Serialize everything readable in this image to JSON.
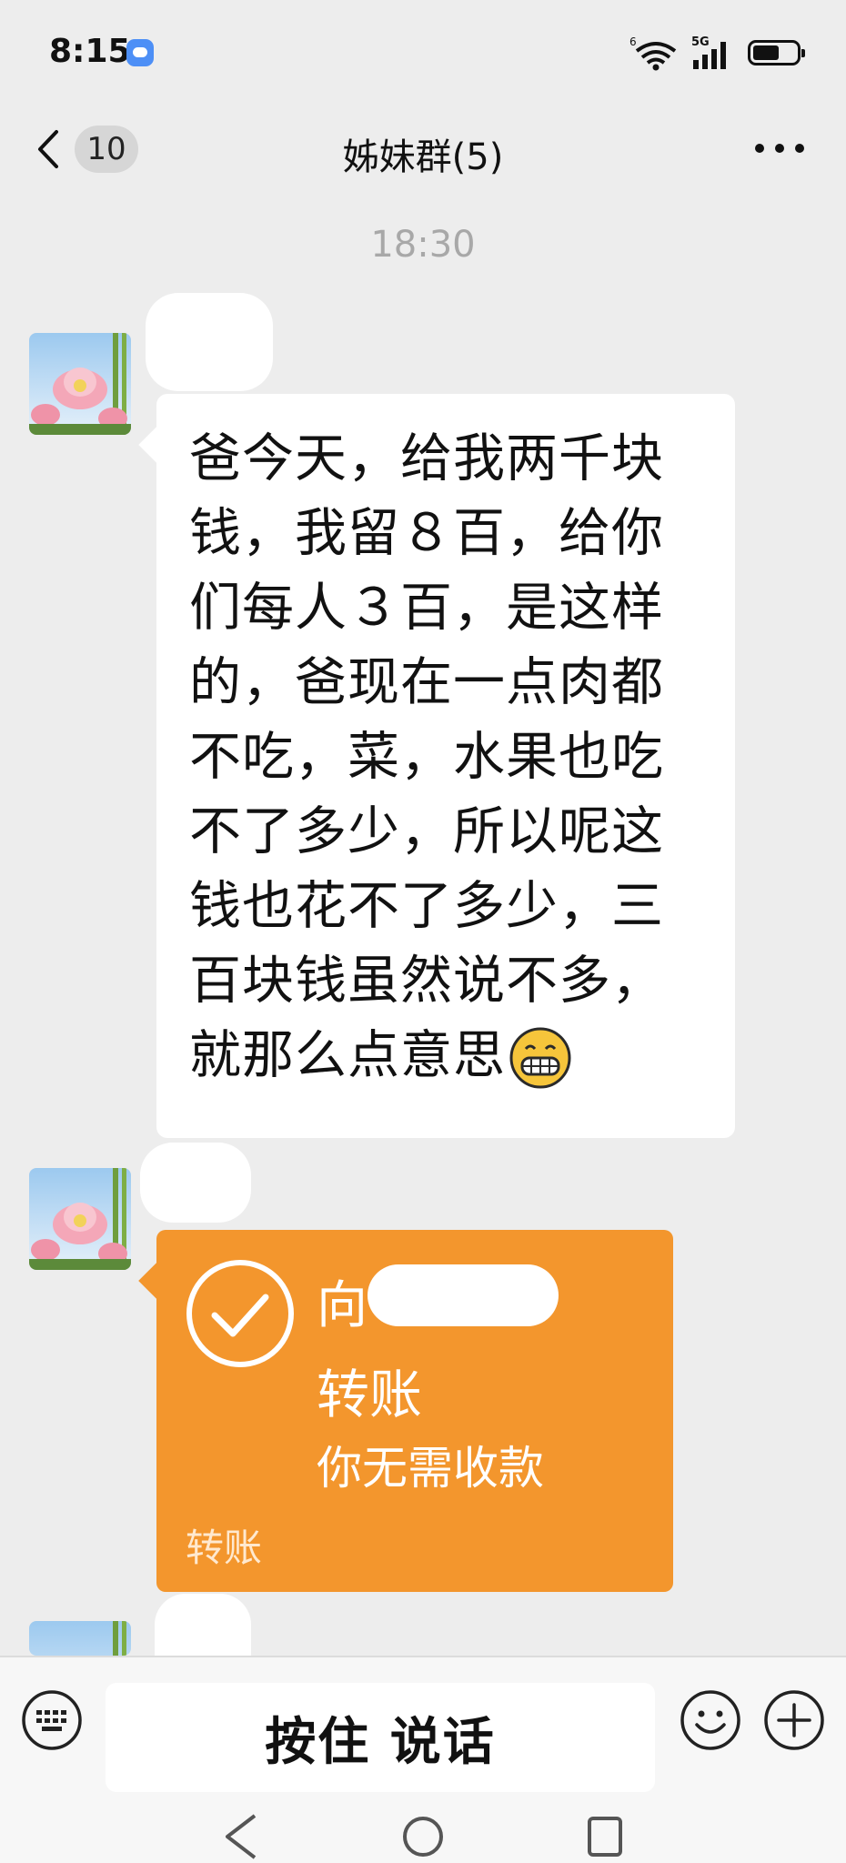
{
  "status_bar": {
    "time": "8:15",
    "network": "5G",
    "wifi_badge": "6"
  },
  "header": {
    "unread_count": "10",
    "title": "姊妹群(5)"
  },
  "chat": {
    "timestamp": "18:30",
    "messages": [
      {
        "type": "text",
        "text": "爸今天，给我两千块钱，我留８百，给你们每人３百，是这样的，爸现在一点肉都不吃，菜，水果也吃不了多少，所以呢这钱也花不了多少，三百块钱虽然说不多，就那么点意思",
        "emoji": "grinning-face"
      },
      {
        "type": "transfer",
        "prefix": "向",
        "title": "转账",
        "status": "你无需收款",
        "footer": "转账"
      }
    ]
  },
  "input": {
    "voice_label": "按住 说话"
  },
  "colors": {
    "background": "#ededed",
    "transfer": "#f3962d",
    "bubble": "#ffffff"
  }
}
